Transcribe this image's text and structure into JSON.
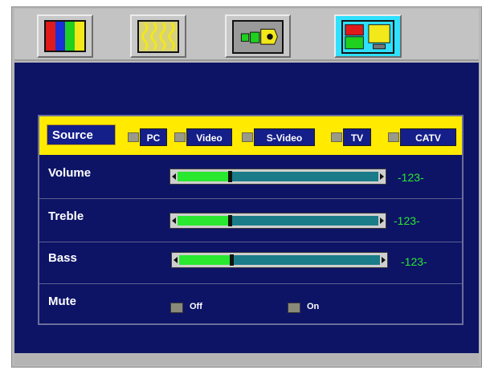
{
  "tabs": [
    {
      "icon": "color-bars-icon",
      "active": false
    },
    {
      "icon": "wavy-lines-icon",
      "active": false
    },
    {
      "icon": "audio-connector-icon",
      "active": false
    },
    {
      "icon": "screen-layout-icon",
      "active": true
    }
  ],
  "source": {
    "label": "Source",
    "options": [
      "PC",
      "Video",
      "S-Video",
      "TV",
      "CATV"
    ]
  },
  "rows": [
    {
      "label": "Volume",
      "value_text": "-123-",
      "level": 0.25
    },
    {
      "label": "Treble",
      "value_text": "-123-",
      "level": 0.25
    },
    {
      "label": "Bass",
      "value_text": "-123-",
      "level": 0.25
    }
  ],
  "mute": {
    "label": "Mute",
    "options": [
      "Off",
      "On"
    ]
  },
  "colors": {
    "panel": "#0d1466",
    "source_bar": "#ffea00",
    "accent_green": "#29e82f",
    "active_tab": "#2fe0ff"
  }
}
